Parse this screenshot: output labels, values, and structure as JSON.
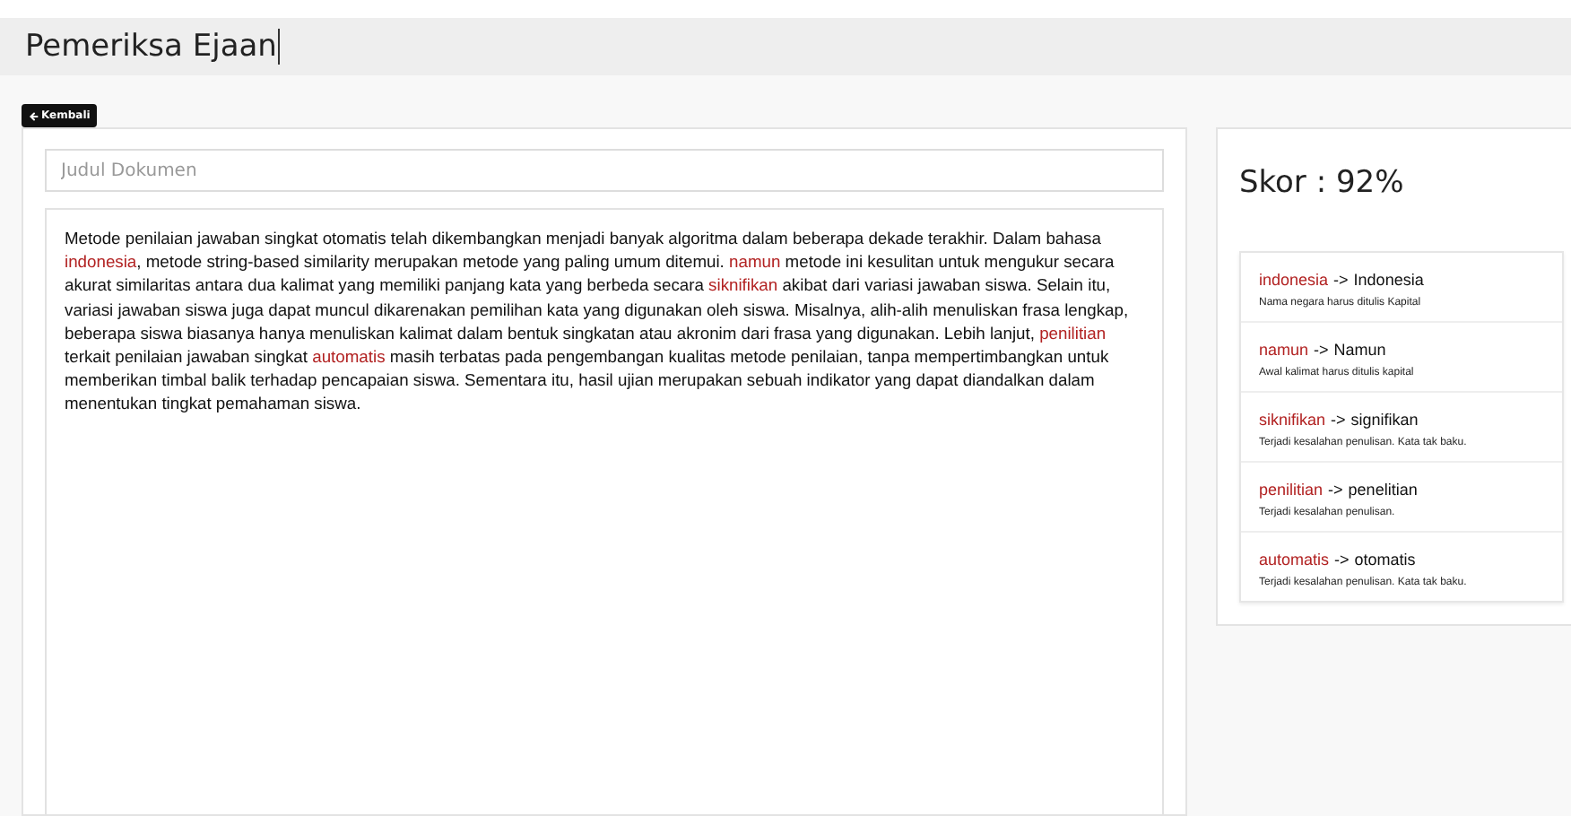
{
  "header": {
    "title": "Pemeriksa Ejaan"
  },
  "back_button": {
    "label": "Kembali"
  },
  "document": {
    "title_placeholder": "Judul Dokumen",
    "segments": [
      {
        "text": "Metode penilaian jawaban singkat otomatis telah dikembangkan menjadi banyak algoritma dalam beberapa dekade terakhir. Dalam bahasa ",
        "error": false
      },
      {
        "text": "indonesia",
        "error": true
      },
      {
        "text": ", metode string-based similarity merupakan metode yang paling umum ditemui. ",
        "error": false
      },
      {
        "text": "namun",
        "error": true
      },
      {
        "text": " metode ini kesulitan untuk mengukur secara akurat similaritas antara dua kalimat yang memiliki panjang kata yang berbeda secara ",
        "error": false
      },
      {
        "text": "siknifikan",
        "error": true
      },
      {
        "text": " akibat dari variasi jawaban siswa. Selain itu, variasi jawaban siswa juga dapat muncul dikarenakan pemilihan kata yang digunakan oleh siswa. Misalnya, alih-alih menuliskan frasa lengkap, beberapa siswa biasanya hanya menuliskan kalimat dalam bentuk singkatan atau akronim dari frasa yang digunakan. Lebih lanjut, ",
        "error": false
      },
      {
        "text": "penilitian",
        "error": true
      },
      {
        "text": " terkait penilaian jawaban singkat ",
        "error": false
      },
      {
        "text": "automatis",
        "error": true
      },
      {
        "text": " masih terbatas pada pengembangan kualitas metode penilaian, tanpa mempertimbangkan untuk memberikan timbal balik terhadap pencapaian siswa. Sementara itu, hasil ujian merupakan sebuah indikator yang dapat diandalkan dalam menentukan tingkat pemahaman siswa.",
        "error": false
      }
    ]
  },
  "score": "Skor : 92%",
  "corrections": [
    {
      "wrong": "indonesia",
      "arrow": "->",
      "right": "Indonesia",
      "note": "Nama negara harus ditulis Kapital"
    },
    {
      "wrong": "namun",
      "arrow": "->",
      "right": "Namun",
      "note": "Awal kalimat harus ditulis kapital"
    },
    {
      "wrong": "siknifikan",
      "arrow": "->",
      "right": "signifikan",
      "note": "Terjadi kesalahan penulisan. Kata tak baku."
    },
    {
      "wrong": "penilitian",
      "arrow": "->",
      "right": "penelitian",
      "note": "Terjadi kesalahan penulisan."
    },
    {
      "wrong": "automatis",
      "arrow": "->",
      "right": "otomatis",
      "note": "Terjadi kesalahan penulisan. Kata tak baku."
    }
  ]
}
